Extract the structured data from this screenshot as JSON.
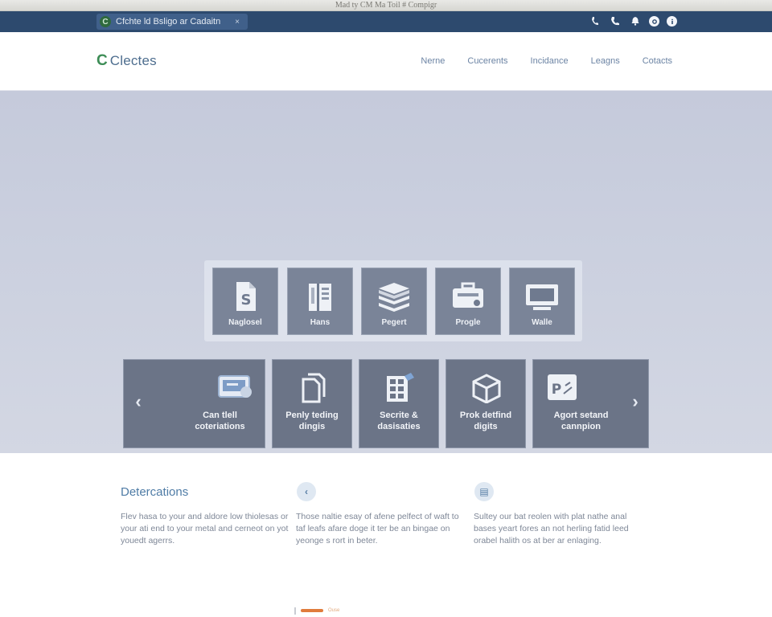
{
  "os_window": {
    "title": "Mad ty CM Ma Toil # Compigr"
  },
  "browser": {
    "tab": {
      "favicon": "C",
      "title": "Cfchte ld Bsligo ar Cadaitn",
      "close": "×"
    },
    "toolbar_icons": [
      "phone-icon",
      "call-icon",
      "bell-icon",
      "settings-icon",
      "info-icon"
    ]
  },
  "site": {
    "logo": {
      "mark": "C",
      "text": "Clectes"
    },
    "nav": [
      "Nerne",
      "Cucerents",
      "Incidance",
      "Leagns",
      "Cotacts"
    ]
  },
  "hero": {
    "tiles": [
      {
        "label": "Naglosel",
        "icon": "document-s-icon"
      },
      {
        "label": "Hans",
        "icon": "book-icon"
      },
      {
        "label": "Pegert",
        "icon": "stack-icon"
      },
      {
        "label": "Progle",
        "icon": "briefcase-icon"
      },
      {
        "label": "Walle",
        "icon": "monitor-icon"
      }
    ],
    "cards": [
      {
        "label": "Can tlell coteriations",
        "icon": "id-card-icon"
      },
      {
        "label": "Penly teding dingis",
        "icon": "files-icon"
      },
      {
        "label": "Secrite & dasisaties",
        "icon": "calculator-icon"
      },
      {
        "label": "Prok detfind digits",
        "icon": "box-icon"
      },
      {
        "label": "Agort setand cannpion",
        "icon": "presentation-icon"
      }
    ],
    "prev_arrow": "‹",
    "next_arrow": "›"
  },
  "features": {
    "title": "Detercations",
    "columns": [
      {
        "icon": "",
        "text": "Flev hasa to your and aldore low thiolesas or your ati end to your metal and cerneot on yot youedt agerrs."
      },
      {
        "icon": "‹",
        "text": "Those naltie esay of afene pelfect of waft to taf leafs afare doge it ter be an bingae on yeonge s rort in beter."
      },
      {
        "icon": "▤",
        "text": "Sultey our bat reolen with plat nathe anal bases yeart fores an not herling fatid leed orabel halith os at ber ar enlaging."
      }
    ]
  },
  "footer": {
    "text": "Ouse"
  },
  "colors": {
    "browser_bar": "#2d4a6e",
    "hero_bg": "#c5cadb",
    "tile_bg": "#7a8498",
    "card_bg": "#6b7487",
    "accent_green": "#3d8d56",
    "link_blue": "#6c84a4",
    "footer_orange": "#e07b3c"
  }
}
